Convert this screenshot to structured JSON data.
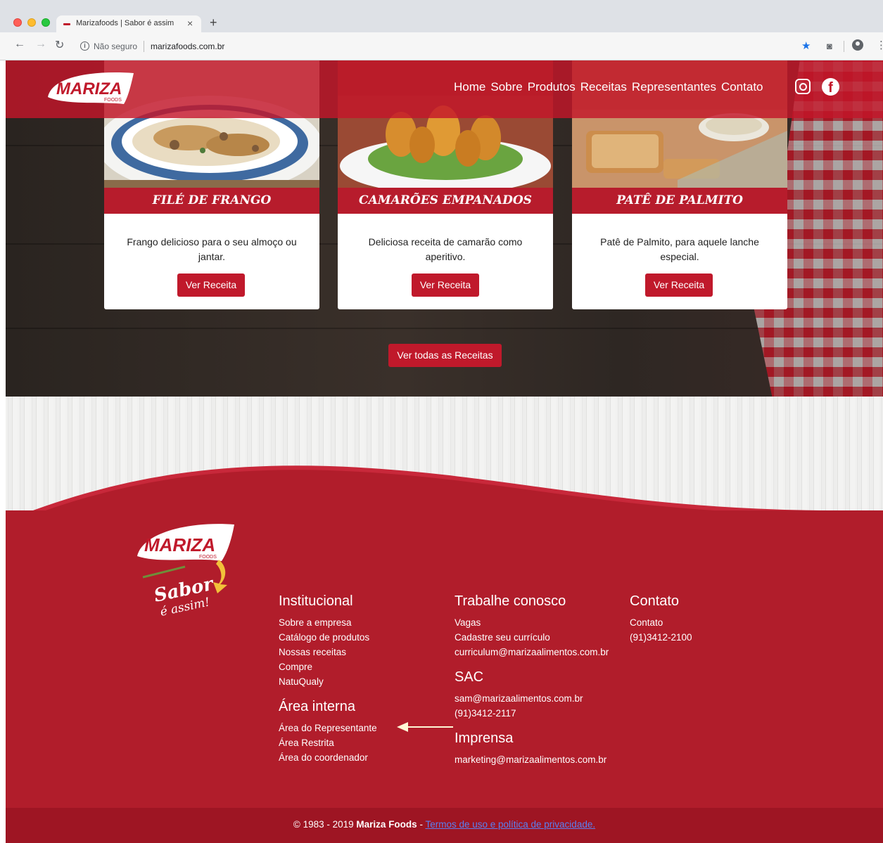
{
  "browser": {
    "tab_title": "Marizafoods | Sabor é assim",
    "tab_close": "×",
    "new_tab": "+",
    "security_label": "Não seguro",
    "url": "marizafoods.com.br"
  },
  "header": {
    "logo_text": "MARIZA",
    "logo_sub": "FOODS",
    "nav": [
      "Home",
      "Sobre",
      "Produtos",
      "Receitas",
      "Representantes",
      "Contato"
    ]
  },
  "recipes": [
    {
      "title": "FILÉ DE FRANGO",
      "description": "Frango delicioso para o seu almoço ou jantar.",
      "button": "Ver Receita"
    },
    {
      "title": "CAMARÕES EMPANADOS",
      "description": "Deliciosa receita de camarão como aperitivo.",
      "button": "Ver Receita"
    },
    {
      "title": "PATÊ DE PALMITO",
      "description": "Patê de Palmito, para aquele lanche especial.",
      "button": "Ver Receita"
    }
  ],
  "all_recipes_button": "Ver todas as Receitas",
  "footer": {
    "logo_text": "MARIZA",
    "logo_sub": "FOODS",
    "slogan_1": "Sabor",
    "slogan_2": "é assim!",
    "institucional": {
      "title": "Institucional",
      "links": [
        "Sobre a empresa",
        "Catálogo de produtos",
        "Nossas receitas",
        "Compre",
        "NatuQualy"
      ]
    },
    "area_interna": {
      "title": "Área interna",
      "links": [
        "Área do Representante",
        "Área Restrita",
        "Área do coordenador"
      ]
    },
    "trabalhe": {
      "title": "Trabalhe conosco",
      "links": [
        "Vagas",
        "Cadastre seu currículo",
        "curriculum@marizaalimentos.com.br"
      ]
    },
    "sac": {
      "title": "SAC",
      "links": [
        "sam@marizaalimentos.com.br",
        "(91)3412-2117"
      ]
    },
    "imprensa": {
      "title": "Imprensa",
      "links": [
        "marketing@marizaalimentos.com.br"
      ]
    },
    "contato": {
      "title": "Contato",
      "links": [
        "Contato",
        "(91)3412-2100"
      ]
    },
    "copyright_prefix": "© 1983 - 2019 ",
    "copyright_brand": "Mariza Foods",
    "copyright_dash": " - ",
    "terms": "Termos de uso e política de privacidade."
  },
  "colors": {
    "brand_red": "#c0192b",
    "footer_red": "#b11d2b",
    "link_blue": "#5b7ff0",
    "arrow": "#fff7d6"
  }
}
